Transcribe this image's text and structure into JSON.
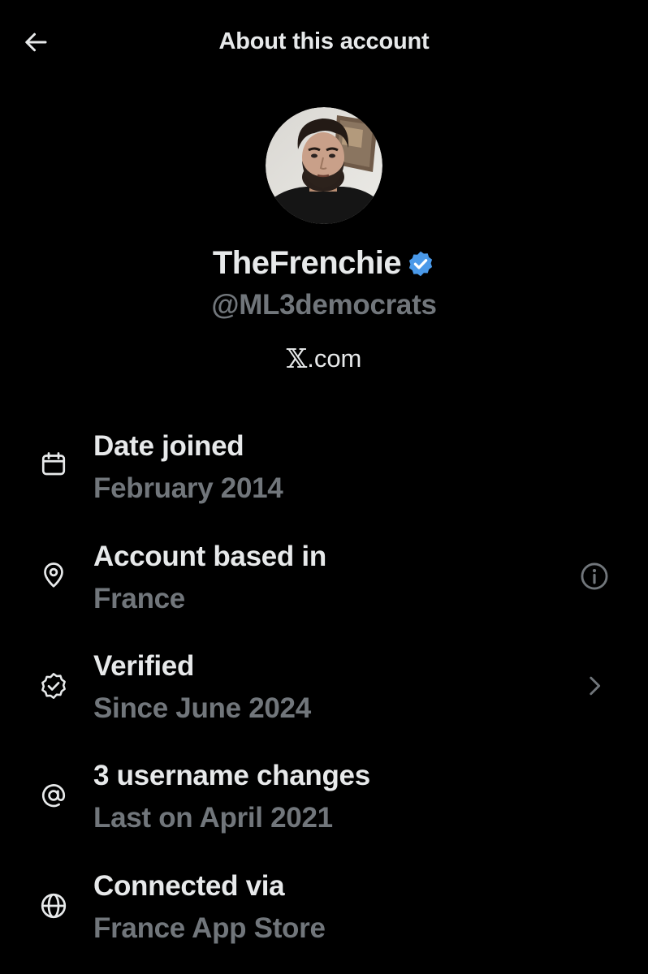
{
  "header": {
    "title": "About this account",
    "back_icon": "arrow-left-icon"
  },
  "profile": {
    "display_name": "TheFrenchie",
    "verified": true,
    "verified_color": "#4a99e9",
    "handle": "@ML3democrats",
    "site_x": "𝕏",
    "site_suffix": ".com"
  },
  "items": [
    {
      "icon": "calendar-icon",
      "label": "Date joined",
      "value": "February 2014",
      "trailing": null
    },
    {
      "icon": "location-pin-icon",
      "label": "Account based in",
      "value": "France",
      "trailing": "info-icon"
    },
    {
      "icon": "verified-outline-icon",
      "label": "Verified",
      "value": "Since June 2024",
      "trailing": "chevron-right-icon"
    },
    {
      "icon": "at-sign-icon",
      "label": "3 username changes",
      "value": "Last on April 2021",
      "trailing": null
    },
    {
      "icon": "globe-icon",
      "label": "Connected via",
      "value": "France App Store",
      "trailing": null
    }
  ],
  "colors": {
    "background": "#000000",
    "primary_text": "#e7e9ea",
    "secondary_text": "#71767b",
    "accent": "#4a99e9"
  }
}
